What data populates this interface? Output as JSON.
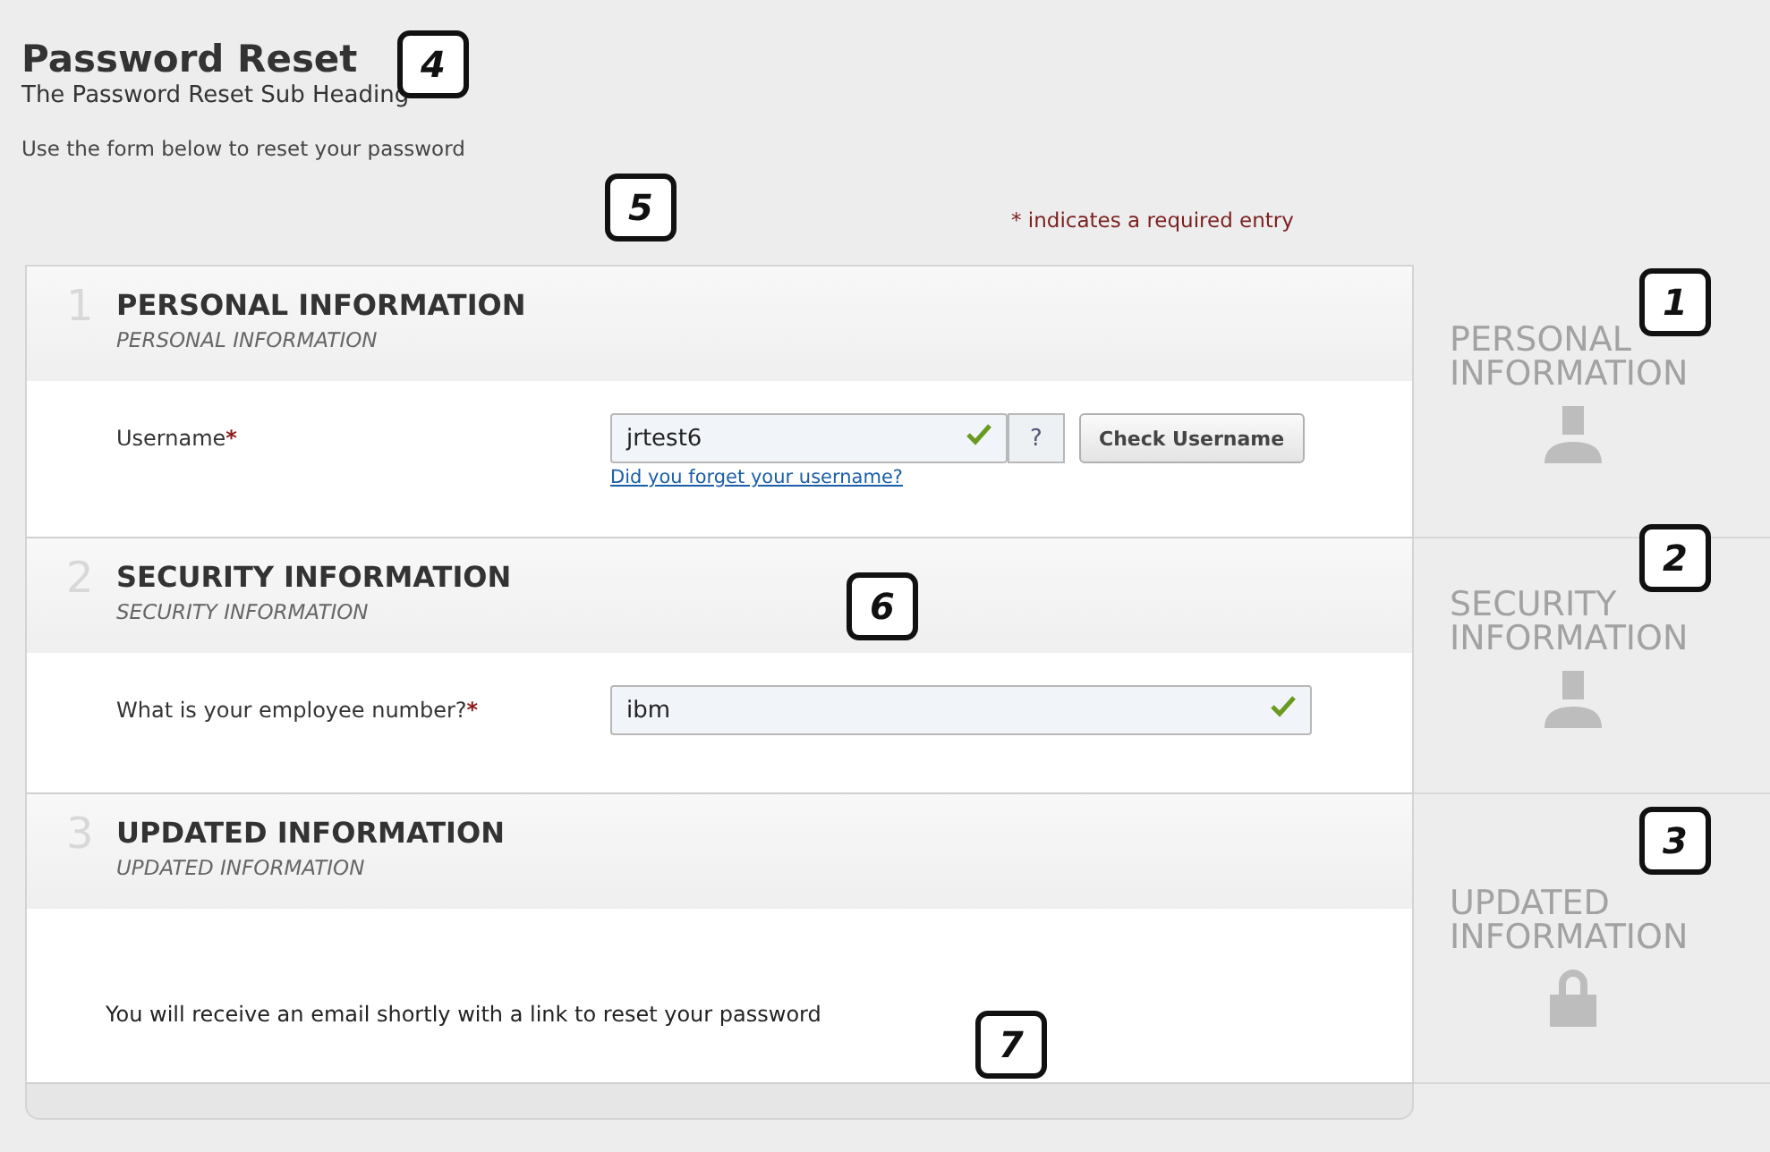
{
  "heading": {
    "title": "Password Reset",
    "subtitle": "The Password Reset Sub Heading",
    "instruction": "Use the form below to reset your password"
  },
  "required_note": "* indicates a required entry",
  "required_mark": "*",
  "sections": [
    {
      "number": "1",
      "title": "PERSONAL INFORMATION",
      "subtitle": "PERSONAL INFORMATION",
      "kind": "field",
      "field": {
        "label": "Username",
        "required": true,
        "value": "jrtest6",
        "valid": true,
        "help": "?",
        "button": "Check Username",
        "link": "Did you forget your username?"
      }
    },
    {
      "number": "2",
      "title": "SECURITY INFORMATION",
      "subtitle": "SECURITY INFORMATION",
      "kind": "field",
      "field": {
        "label": "What is your employee number?",
        "required": true,
        "value": "ibm",
        "valid": true
      }
    },
    {
      "number": "3",
      "title": "UPDATED INFORMATION",
      "subtitle": "UPDATED INFORMATION",
      "kind": "message",
      "message": "You will receive an email shortly with a link to reset your password"
    }
  ],
  "side_steps": [
    {
      "label": "PERSONAL INFORMATION",
      "kind": "person"
    },
    {
      "label": "SECURITY INFORMATION",
      "kind": "person"
    },
    {
      "label": "UPDATED INFORMATION",
      "kind": "lock"
    }
  ],
  "callouts": [
    {
      "label": "4"
    },
    {
      "label": "5"
    },
    {
      "label": "1"
    },
    {
      "label": "6"
    },
    {
      "label": "2"
    },
    {
      "label": "3"
    },
    {
      "label": "7"
    }
  ]
}
